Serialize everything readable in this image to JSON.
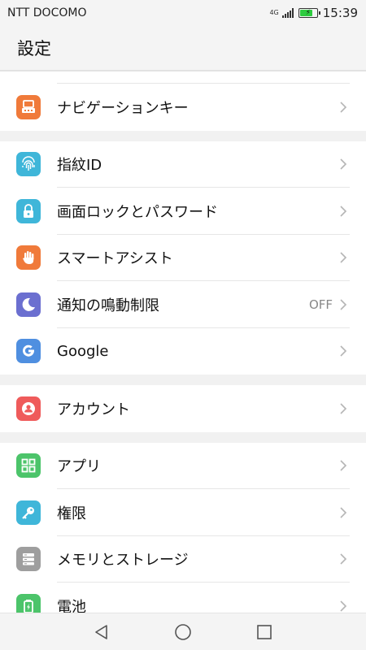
{
  "status_bar": {
    "carrier": "NTT DOCOMO",
    "network": "4G",
    "time": "15:39",
    "battery_level": 0.8
  },
  "header": {
    "title": "設定"
  },
  "sections": [
    [
      {
        "label": "ナビゲーションキー",
        "icon": "navigation-key-icon",
        "color": "#f07a3a"
      }
    ],
    [
      {
        "label": "指紋ID",
        "icon": "fingerprint-icon",
        "color": "#3fb6d9"
      },
      {
        "label": "画面ロックとパスワード",
        "icon": "lock-icon",
        "color": "#3fb6d9"
      },
      {
        "label": "スマートアシスト",
        "icon": "hand-icon",
        "color": "#f07a3a"
      },
      {
        "label": "通知の鳴動制限",
        "icon": "moon-icon",
        "color": "#6b6fd0",
        "value": "OFF"
      },
      {
        "label": "Google",
        "icon": "google-icon",
        "color": "#4f8fe0"
      }
    ],
    [
      {
        "label": "アカウント",
        "icon": "account-icon",
        "color": "#ef5b5b"
      }
    ],
    [
      {
        "label": "アプリ",
        "icon": "apps-icon",
        "color": "#4cc46a"
      },
      {
        "label": "権限",
        "icon": "key-icon",
        "color": "#3fb6d9"
      },
      {
        "label": "メモリとストレージ",
        "icon": "storage-icon",
        "color": "#9e9e9e"
      },
      {
        "label": "電池",
        "icon": "battery-icon",
        "color": "#4cc46a"
      }
    ]
  ]
}
